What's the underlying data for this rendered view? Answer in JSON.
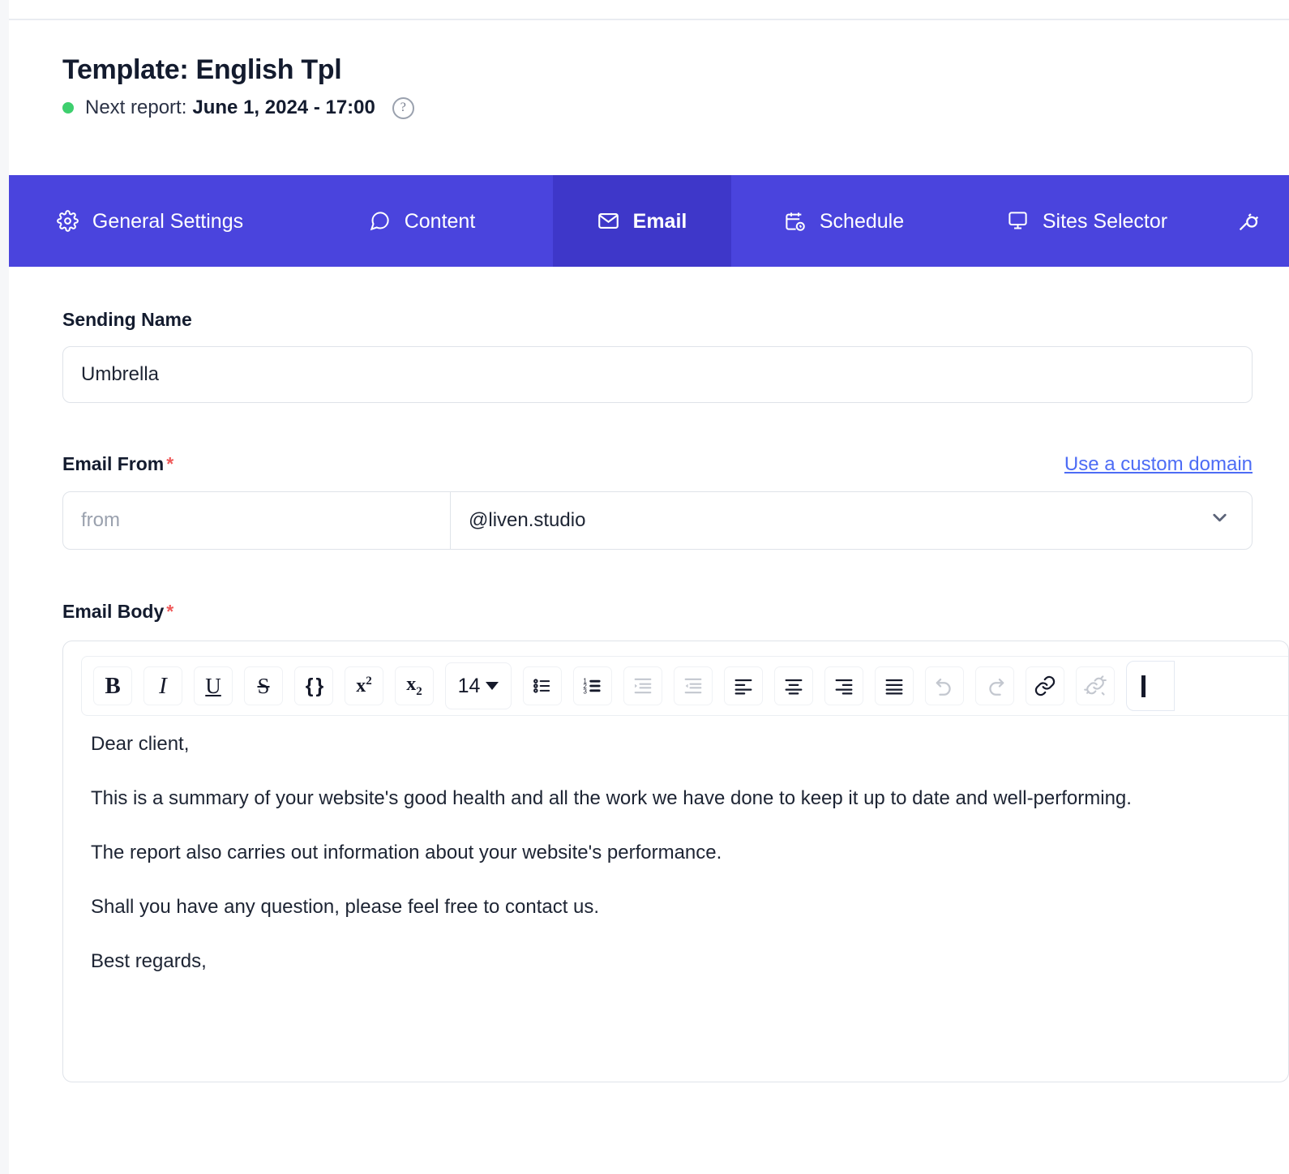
{
  "header": {
    "title": "Template: English Tpl",
    "status_dot_color": "#3ecf6e",
    "next_report_label": "Next report:",
    "next_report_value": "June 1, 2024 - 17:00",
    "help_icon": "?"
  },
  "tabs": {
    "bar_color": "#4a44dd",
    "active_color": "#3e37c9",
    "items": [
      {
        "label": "General Settings",
        "icon": "gear-icon",
        "active": false
      },
      {
        "label": "Content",
        "icon": "comment-icon",
        "active": false
      },
      {
        "label": "Email",
        "icon": "envelope-icon",
        "active": true
      },
      {
        "label": "Schedule",
        "icon": "calendar-clock-icon",
        "active": false
      },
      {
        "label": "Sites Selector",
        "icon": "monitor-icon",
        "active": false
      },
      {
        "label": "",
        "icon": "plug-icon",
        "active": false
      }
    ]
  },
  "form": {
    "sending_name": {
      "label": "Sending Name",
      "value": "Umbrella"
    },
    "email_from": {
      "label": "Email From",
      "required_mark": "*",
      "custom_domain_link": "Use a custom domain",
      "local_placeholder": "from",
      "domain_value": "@liven.studio"
    },
    "email_body": {
      "label": "Email Body",
      "required_mark": "*",
      "font_size": "14",
      "toolbar": [
        {
          "name": "bold-button",
          "glyph": "B",
          "enabled": true
        },
        {
          "name": "italic-button",
          "glyph": "I",
          "enabled": true
        },
        {
          "name": "underline-button",
          "glyph": "U",
          "enabled": true
        },
        {
          "name": "strikethrough-button",
          "glyph": "S",
          "enabled": true
        },
        {
          "name": "code-block-button",
          "glyph": "{}",
          "enabled": true
        },
        {
          "name": "superscript-button",
          "glyph": "x2",
          "enabled": true
        },
        {
          "name": "subscript-button",
          "glyph": "x2",
          "enabled": true
        },
        {
          "name": "font-size-select",
          "glyph": "14",
          "enabled": true
        },
        {
          "name": "bullet-list-button",
          "glyph": "bullets",
          "enabled": true
        },
        {
          "name": "numbered-list-button",
          "glyph": "numbers",
          "enabled": true
        },
        {
          "name": "indent-button",
          "glyph": "indent",
          "enabled": false
        },
        {
          "name": "outdent-button",
          "glyph": "outdent",
          "enabled": false
        },
        {
          "name": "align-left-button",
          "glyph": "align-left",
          "enabled": true
        },
        {
          "name": "align-center-button",
          "glyph": "align-center",
          "enabled": true
        },
        {
          "name": "align-right-button",
          "glyph": "align-right",
          "enabled": true
        },
        {
          "name": "align-justify-button",
          "glyph": "align-justify",
          "enabled": true
        },
        {
          "name": "undo-button",
          "glyph": "undo",
          "enabled": false
        },
        {
          "name": "redo-button",
          "glyph": "redo",
          "enabled": false
        },
        {
          "name": "link-button",
          "glyph": "link",
          "enabled": true
        },
        {
          "name": "unlink-button",
          "glyph": "unlink",
          "enabled": false
        }
      ],
      "paragraphs": [
        "Dear client,",
        "This is a summary of your website's good health and all the work we have done to keep it up to date and well-performing.",
        "The report also carries out information about your website's performance.",
        "Shall you have any question, please feel free to contact us.",
        "Best regards,"
      ]
    }
  }
}
